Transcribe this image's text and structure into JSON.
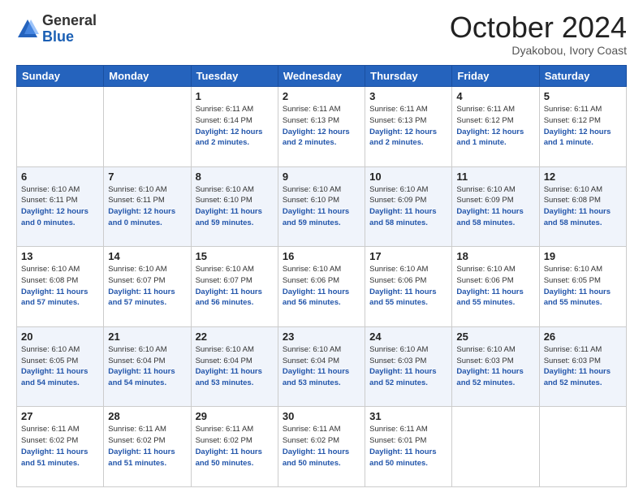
{
  "header": {
    "logo_general": "General",
    "logo_blue": "Blue",
    "month_title": "October 2024",
    "subtitle": "Dyakobou, Ivory Coast"
  },
  "days_of_week": [
    "Sunday",
    "Monday",
    "Tuesday",
    "Wednesday",
    "Thursday",
    "Friday",
    "Saturday"
  ],
  "weeks": [
    [
      {
        "day": "",
        "info": ""
      },
      {
        "day": "",
        "info": ""
      },
      {
        "day": "1",
        "info": "Sunrise: 6:11 AM\nSunset: 6:14 PM\nDaylight: 12 hours and 2 minutes."
      },
      {
        "day": "2",
        "info": "Sunrise: 6:11 AM\nSunset: 6:13 PM\nDaylight: 12 hours and 2 minutes."
      },
      {
        "day": "3",
        "info": "Sunrise: 6:11 AM\nSunset: 6:13 PM\nDaylight: 12 hours and 2 minutes."
      },
      {
        "day": "4",
        "info": "Sunrise: 6:11 AM\nSunset: 6:12 PM\nDaylight: 12 hours and 1 minute."
      },
      {
        "day": "5",
        "info": "Sunrise: 6:11 AM\nSunset: 6:12 PM\nDaylight: 12 hours and 1 minute."
      }
    ],
    [
      {
        "day": "6",
        "info": "Sunrise: 6:10 AM\nSunset: 6:11 PM\nDaylight: 12 hours and 0 minutes."
      },
      {
        "day": "7",
        "info": "Sunrise: 6:10 AM\nSunset: 6:11 PM\nDaylight: 12 hours and 0 minutes."
      },
      {
        "day": "8",
        "info": "Sunrise: 6:10 AM\nSunset: 6:10 PM\nDaylight: 11 hours and 59 minutes."
      },
      {
        "day": "9",
        "info": "Sunrise: 6:10 AM\nSunset: 6:10 PM\nDaylight: 11 hours and 59 minutes."
      },
      {
        "day": "10",
        "info": "Sunrise: 6:10 AM\nSunset: 6:09 PM\nDaylight: 11 hours and 58 minutes."
      },
      {
        "day": "11",
        "info": "Sunrise: 6:10 AM\nSunset: 6:09 PM\nDaylight: 11 hours and 58 minutes."
      },
      {
        "day": "12",
        "info": "Sunrise: 6:10 AM\nSunset: 6:08 PM\nDaylight: 11 hours and 58 minutes."
      }
    ],
    [
      {
        "day": "13",
        "info": "Sunrise: 6:10 AM\nSunset: 6:08 PM\nDaylight: 11 hours and 57 minutes."
      },
      {
        "day": "14",
        "info": "Sunrise: 6:10 AM\nSunset: 6:07 PM\nDaylight: 11 hours and 57 minutes."
      },
      {
        "day": "15",
        "info": "Sunrise: 6:10 AM\nSunset: 6:07 PM\nDaylight: 11 hours and 56 minutes."
      },
      {
        "day": "16",
        "info": "Sunrise: 6:10 AM\nSunset: 6:06 PM\nDaylight: 11 hours and 56 minutes."
      },
      {
        "day": "17",
        "info": "Sunrise: 6:10 AM\nSunset: 6:06 PM\nDaylight: 11 hours and 55 minutes."
      },
      {
        "day": "18",
        "info": "Sunrise: 6:10 AM\nSunset: 6:06 PM\nDaylight: 11 hours and 55 minutes."
      },
      {
        "day": "19",
        "info": "Sunrise: 6:10 AM\nSunset: 6:05 PM\nDaylight: 11 hours and 55 minutes."
      }
    ],
    [
      {
        "day": "20",
        "info": "Sunrise: 6:10 AM\nSunset: 6:05 PM\nDaylight: 11 hours and 54 minutes."
      },
      {
        "day": "21",
        "info": "Sunrise: 6:10 AM\nSunset: 6:04 PM\nDaylight: 11 hours and 54 minutes."
      },
      {
        "day": "22",
        "info": "Sunrise: 6:10 AM\nSunset: 6:04 PM\nDaylight: 11 hours and 53 minutes."
      },
      {
        "day": "23",
        "info": "Sunrise: 6:10 AM\nSunset: 6:04 PM\nDaylight: 11 hours and 53 minutes."
      },
      {
        "day": "24",
        "info": "Sunrise: 6:10 AM\nSunset: 6:03 PM\nDaylight: 11 hours and 52 minutes."
      },
      {
        "day": "25",
        "info": "Sunrise: 6:10 AM\nSunset: 6:03 PM\nDaylight: 11 hours and 52 minutes."
      },
      {
        "day": "26",
        "info": "Sunrise: 6:11 AM\nSunset: 6:03 PM\nDaylight: 11 hours and 52 minutes."
      }
    ],
    [
      {
        "day": "27",
        "info": "Sunrise: 6:11 AM\nSunset: 6:02 PM\nDaylight: 11 hours and 51 minutes."
      },
      {
        "day": "28",
        "info": "Sunrise: 6:11 AM\nSunset: 6:02 PM\nDaylight: 11 hours and 51 minutes."
      },
      {
        "day": "29",
        "info": "Sunrise: 6:11 AM\nSunset: 6:02 PM\nDaylight: 11 hours and 50 minutes."
      },
      {
        "day": "30",
        "info": "Sunrise: 6:11 AM\nSunset: 6:02 PM\nDaylight: 11 hours and 50 minutes."
      },
      {
        "day": "31",
        "info": "Sunrise: 6:11 AM\nSunset: 6:01 PM\nDaylight: 11 hours and 50 minutes."
      },
      {
        "day": "",
        "info": ""
      },
      {
        "day": "",
        "info": ""
      }
    ]
  ]
}
